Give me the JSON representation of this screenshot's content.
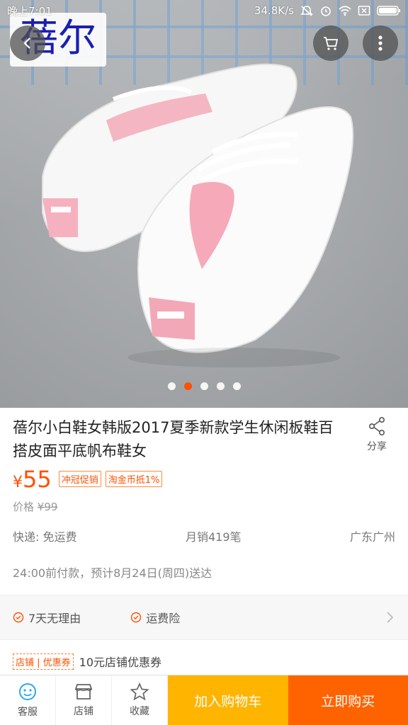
{
  "status_bar": {
    "time": "晚上7:01",
    "network_speed": "34.8K/s"
  },
  "hero": {
    "brand_watermark": "蓓尔",
    "slide_count": 5,
    "active_slide": 2
  },
  "product": {
    "title": "蓓尔小白鞋女韩版2017夏季新款学生休闲板鞋百搭皮面平底帆布鞋女",
    "share_label": "分享",
    "currency_symbol": "¥",
    "price": "55",
    "tags": [
      "冲冠促销",
      "淘金币抵1%"
    ],
    "original_price_label": "价格",
    "original_price": "¥99",
    "shipping": "快递: 免运费",
    "monthly_sales": "月销419笔",
    "location": "广东广州",
    "delivery_note": "24:00前付款，预计8月24日(周四)送达"
  },
  "services": {
    "items": [
      "7天无理由",
      "运费险"
    ]
  },
  "coupon": {
    "tag": "店铺 | 优惠券",
    "text": "10元店铺优惠券"
  },
  "bottom_bar": {
    "customer_service": "客服",
    "shop": "店铺",
    "favorite": "收藏",
    "add_to_cart": "加入购物车",
    "buy_now": "立即购买"
  },
  "colors": {
    "accent": "#ff5000",
    "cart_button": "#ffb400",
    "buy_button": "#ff6300"
  }
}
